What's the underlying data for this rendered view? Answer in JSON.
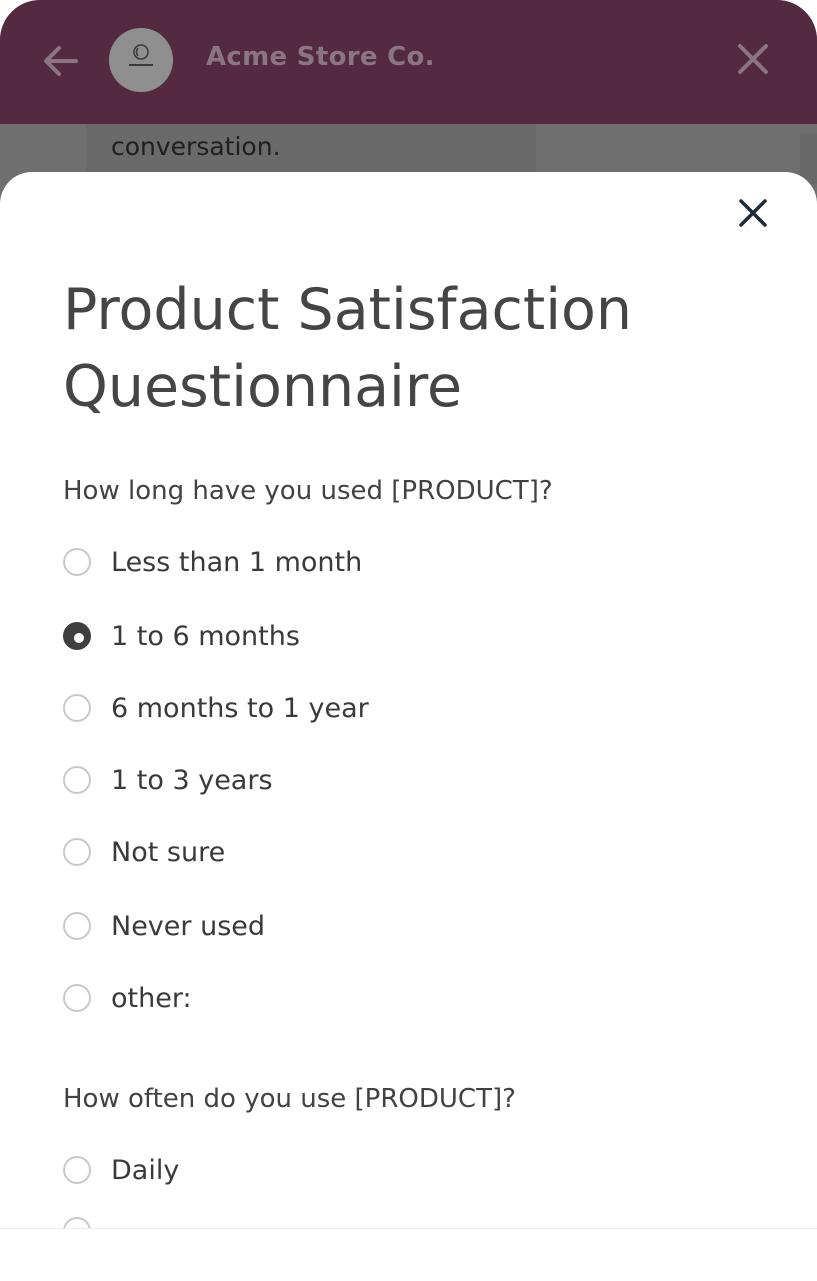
{
  "header": {
    "title": "Acme Store Co."
  },
  "background_message": "conversation.",
  "survey": {
    "title_line1": "Product Satisfaction",
    "title_line2": "Questionnaire",
    "questions": [
      {
        "text": "How long have you used [PRODUCT]?",
        "options": [
          {
            "label": "Less than 1 month",
            "selected": false
          },
          {
            "label": "1 to 6 months",
            "selected": true
          },
          {
            "label": "6 months to 1 year",
            "selected": false
          },
          {
            "label": "1 to 3 years",
            "selected": false
          },
          {
            "label": "Not sure",
            "selected": false
          },
          {
            "label": "Never used",
            "selected": false
          },
          {
            "label": "other:",
            "selected": false
          }
        ]
      },
      {
        "text": "How often do you use [PRODUCT]?",
        "options": [
          {
            "label": "Daily",
            "selected": false
          }
        ]
      }
    ]
  }
}
